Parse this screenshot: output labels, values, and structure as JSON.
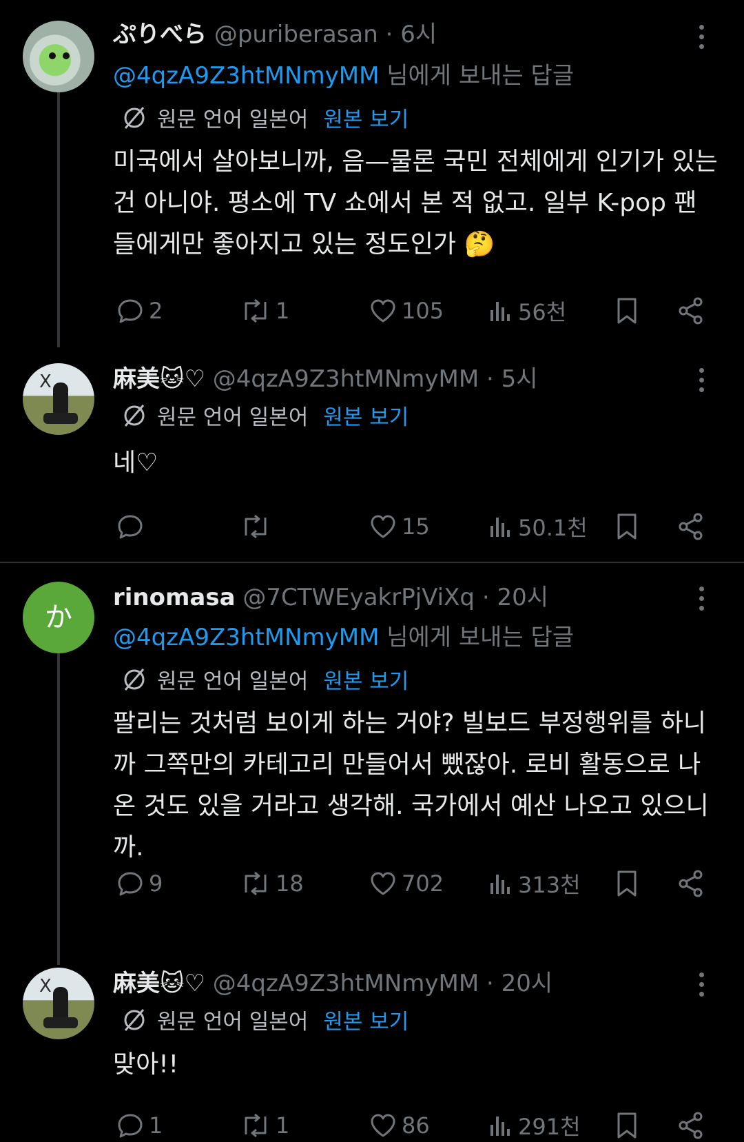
{
  "tweets": [
    {
      "name": "ぷりべら",
      "handle": "@puriberasan",
      "time": "· 6시",
      "reply_mention": "@4qzA9Z3htMNmyMM",
      "reply_suffix": " 님에게 보내는 답글",
      "translate_label": "원문 언어 일본어",
      "translate_link": "원본 보기",
      "text": "미국에서 살아보니까, 음—물론 국민 전체에게 인기가 있는 건 아니야. 평소에 TV 쇼에서 본 적 없고. 일부 K-pop 팬들에게만 좋아지고 있는 정도인가 🤔",
      "replies": "2",
      "retweets": "1",
      "likes": "105",
      "views": "56천"
    },
    {
      "name": "麻美🐱♡",
      "handle": "@4qzA9Z3htMNmyMM",
      "time": "· 5시",
      "translate_label": "원문 언어 일본어",
      "translate_link": "원본 보기",
      "text": "네♡",
      "replies": "",
      "retweets": "",
      "likes": "15",
      "views": "50.1천"
    },
    {
      "name": "rinomasa",
      "handle": "@7CTWEyakrPjViXq",
      "time": "· 20시",
      "avatar_char": "か",
      "reply_mention": "@4qzA9Z3htMNmyMM",
      "reply_suffix": " 님에게 보내는 답글",
      "translate_label": "원문 언어 일본어",
      "translate_link": "원본 보기",
      "text": "팔리는 것처럼 보이게 하는 거야? 빌보드 부정행위를 하니까 그쪽만의 카테고리 만들어서 뺐잖아. 로비 활동으로 나온 것도 있을 거라고 생각해. 국가에서 예산 나오고 있으니까.",
      "replies": "9",
      "retweets": "18",
      "likes": "702",
      "views": "313천"
    },
    {
      "name": "麻美🐱♡",
      "handle": "@4qzA9Z3htMNmyMM",
      "time": "· 20시",
      "translate_label": "원문 언어 일본어",
      "translate_link": "원본 보기",
      "text": "맞아!!",
      "replies": "1",
      "retweets": "1",
      "likes": "86",
      "views": "291천"
    }
  ],
  "colors": {
    "background": "#000000",
    "text": "#e7e9ea",
    "muted": "#71767b",
    "accent": "#1d9bf0"
  },
  "icons": [
    "more-icon",
    "translate-icon",
    "reply-icon",
    "retweet-icon",
    "like-icon",
    "views-icon",
    "bookmark-icon",
    "share-icon"
  ]
}
